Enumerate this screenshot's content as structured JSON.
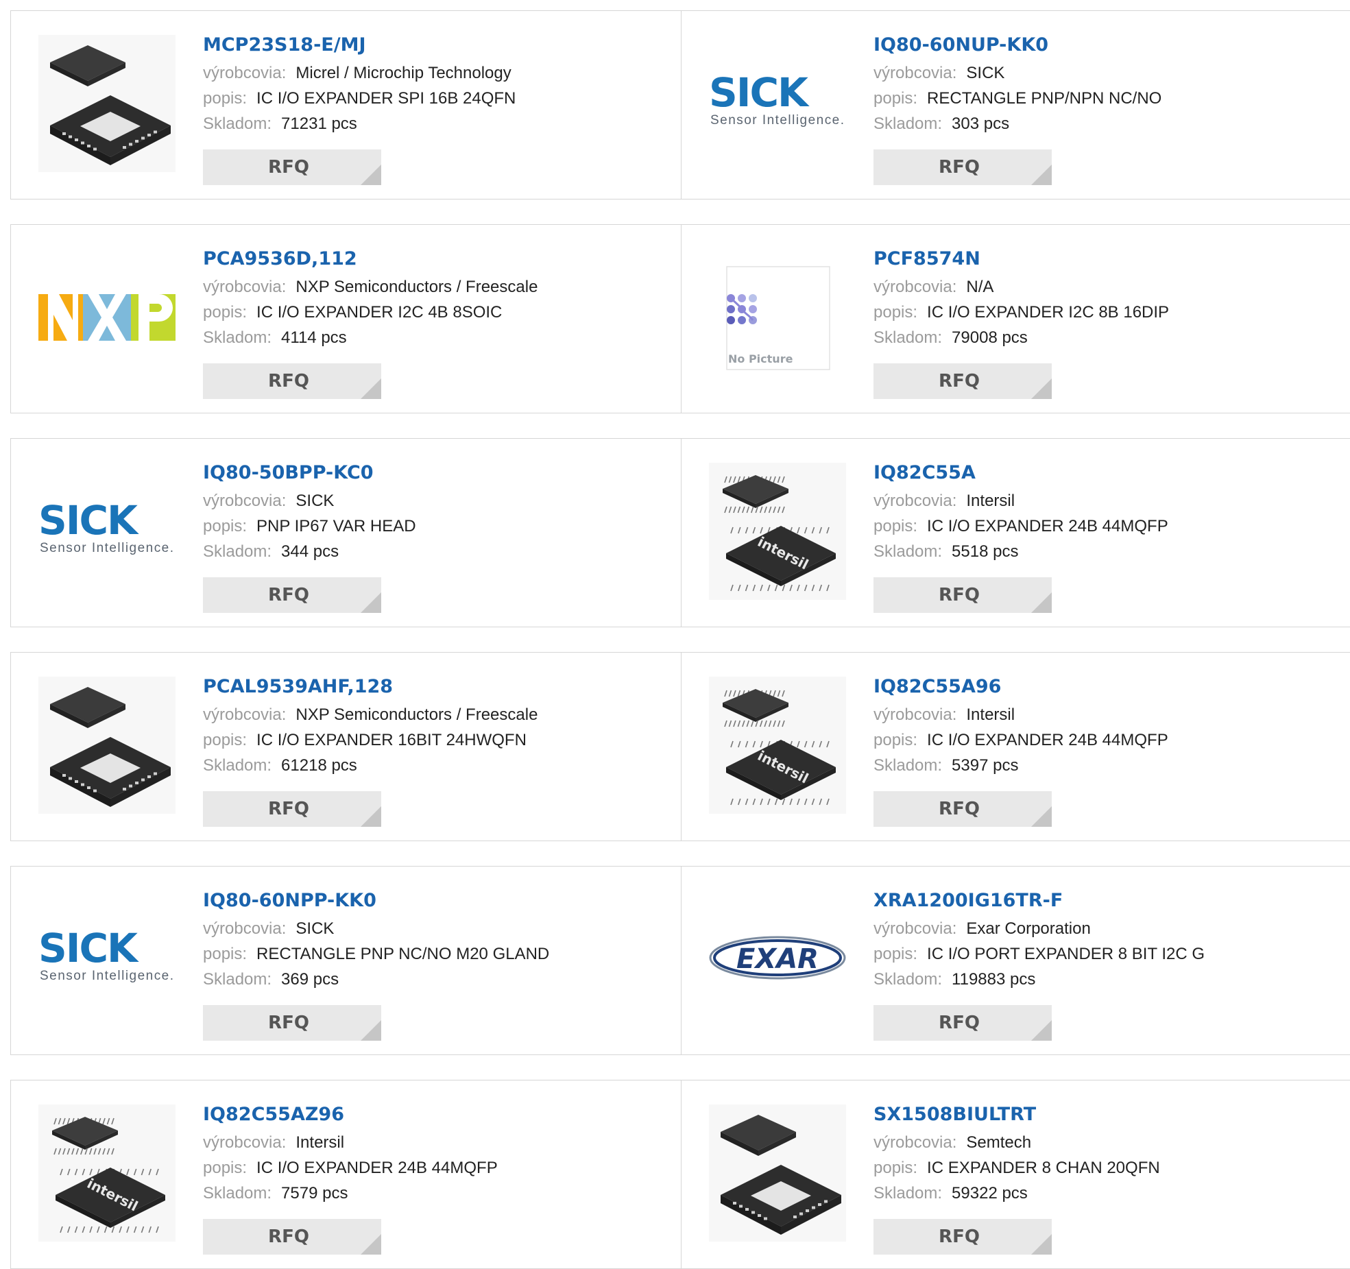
{
  "labels": {
    "manufacturer": "výrobcovia:",
    "description": "popis:",
    "stock": "Skladom:",
    "rfq": "RFQ"
  },
  "products": [
    {
      "part": "MCP23S18-E/MJ",
      "manufacturer": "Micrel / Microchip Technology",
      "description": "IC I/O EXPANDER SPI 16B 24QFN",
      "stock": "71231 pcs",
      "image": "qfn-chip"
    },
    {
      "part": "IQ80-60NUP-KK0",
      "manufacturer": "SICK",
      "description": "RECTANGLE PNP/NPN NC/NO",
      "stock": "303 pcs",
      "image": "sick-logo"
    },
    {
      "part": "PCA9536D,112",
      "manufacturer": "NXP Semiconductors / Freescale",
      "description": "IC I/O EXPANDER I2C 4B 8SOIC",
      "stock": "4114 pcs",
      "image": "nxp-logo"
    },
    {
      "part": "PCF8574N",
      "manufacturer": "N/A",
      "description": "IC I/O EXPANDER I2C 8B 16DIP",
      "stock": "79008 pcs",
      "image": "no-picture"
    },
    {
      "part": "IQ80-50BPP-KC0",
      "manufacturer": "SICK",
      "description": "PNP IP67 VAR HEAD",
      "stock": "344 pcs",
      "image": "sick-logo"
    },
    {
      "part": "IQ82C55A",
      "manufacturer": "Intersil",
      "description": "IC I/O EXPANDER 24B 44MQFP",
      "stock": "5518 pcs",
      "image": "qfp-chip"
    },
    {
      "part": "PCAL9539AHF,128",
      "manufacturer": "NXP Semiconductors / Freescale",
      "description": "IC I/O EXPANDER 16BIT 24HWQFN",
      "stock": "61218 pcs",
      "image": "qfn-chip"
    },
    {
      "part": "IQ82C55A96",
      "manufacturer": "Intersil",
      "description": "IC I/O EXPANDER 24B 44MQFP",
      "stock": "5397 pcs",
      "image": "qfp-chip"
    },
    {
      "part": "IQ80-60NPP-KK0",
      "manufacturer": "SICK",
      "description": "RECTANGLE PNP NC/NO M20 GLAND",
      "stock": "369 pcs",
      "image": "sick-logo"
    },
    {
      "part": "XRA1200IG16TR-F",
      "manufacturer": "Exar Corporation",
      "description": "IC I/O PORT EXPANDER 8 BIT I2C G",
      "stock": "119883 pcs",
      "image": "exar-logo"
    },
    {
      "part": "IQ82C55AZ96",
      "manufacturer": "Intersil",
      "description": "IC I/O EXPANDER 24B 44MQFP",
      "stock": "7579 pcs",
      "image": "qfp-chip"
    },
    {
      "part": "SX1508BIULTRT",
      "manufacturer": "Semtech",
      "description": "IC EXPANDER 8 CHAN 20QFN",
      "stock": "59322 pcs",
      "image": "qfn-chip-small"
    }
  ],
  "image_text": {
    "sick_word": "SICK",
    "sick_tagline": "Sensor Intelligence.",
    "nxp_word": "NXP",
    "no_picture": "No Picture",
    "exar_word": "EXAR",
    "intersil_word": "intersil"
  }
}
